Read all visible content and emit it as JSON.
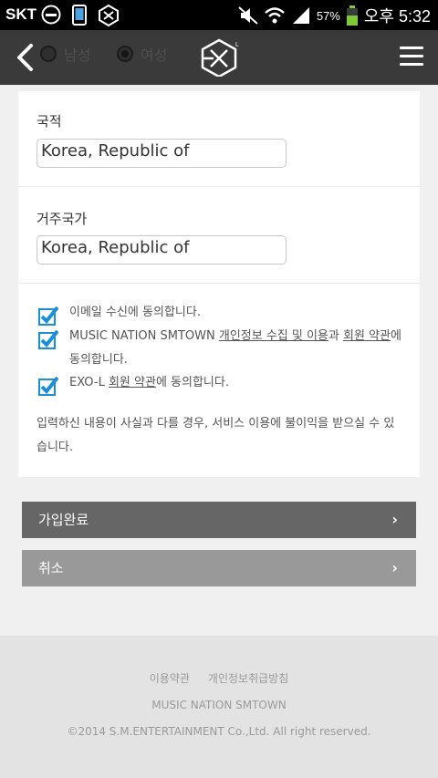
{
  "statusbar": {
    "carrier": "SKT",
    "battery_percent": "57%",
    "time": "오후 5:32"
  },
  "header": {
    "gender_options": [
      "남성",
      "여성"
    ],
    "gender_selected": "여성",
    "logo_icon": "exo-l-logo"
  },
  "form": {
    "nationality_label": "국적",
    "nationality_value": "Korea, Republic of",
    "residence_label": "거주국가",
    "residence_value": "Korea, Republic of",
    "agreements": [
      {
        "text": "이메일 수신에 동의합니다.",
        "checked": true
      },
      {
        "prefix": "MUSIC NATION SMTOWN ",
        "link1": "개인정보 수집 및 이용",
        "mid": "과 ",
        "link2": "회원 약관",
        "suffix": "에 동의합니다.",
        "checked": true
      },
      {
        "prefix": "EXO-L ",
        "link1": "회원 약관",
        "suffix": "에 동의합니다.",
        "checked": true
      }
    ],
    "notice": "입력하신 내용이 사실과 다를 경우, 서비스 이용에 불이익을 받으실 수 있습니다."
  },
  "buttons": {
    "submit_label": "가입완료",
    "cancel_label": "취소"
  },
  "footer": {
    "terms_link": "이용약관",
    "privacy_link": "개인정보취급방침",
    "brand": "MUSIC NATION SMTOWN",
    "copyright": "©2014 S.M.ENTERTAINMENT Co.,Ltd. All right reserved."
  },
  "colors": {
    "header_bg": "#3a3a3a",
    "check_blue": "#1a8fd8",
    "submit_bg": "#666666",
    "cancel_bg": "#999999",
    "footer_bg": "#e3e3e3"
  }
}
